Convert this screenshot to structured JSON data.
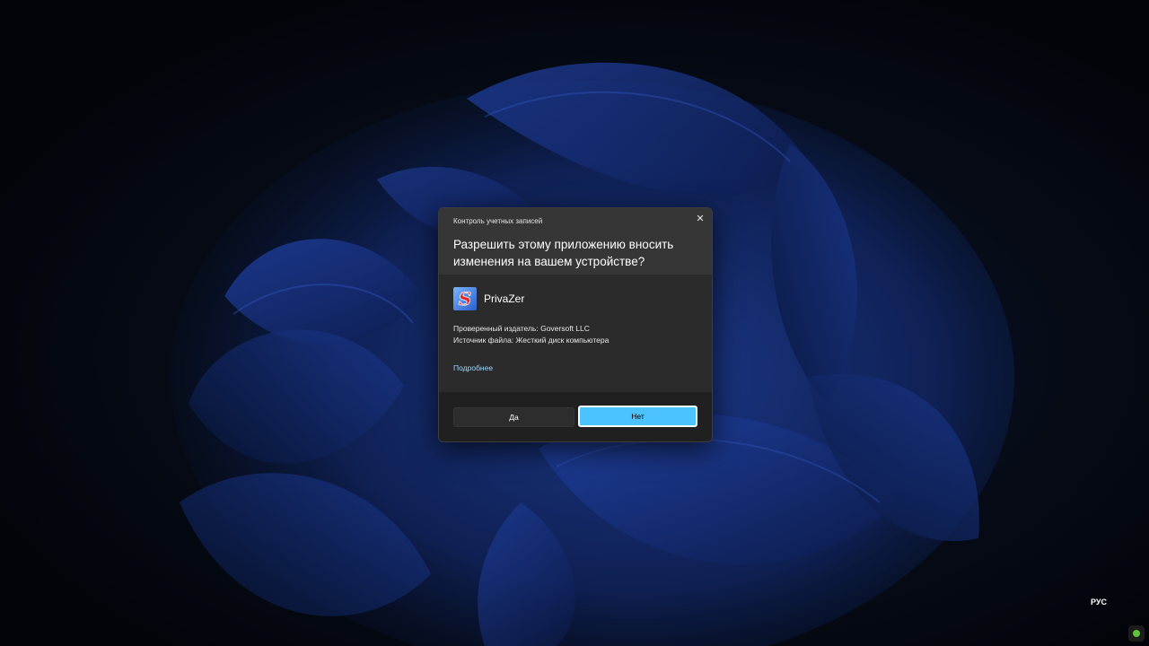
{
  "dialog": {
    "caption": "Контроль учетных записей",
    "question": "Разрешить этому приложению вносить изменения на вашем устройстве?",
    "app_name": "PrivaZer",
    "app_icon_letter": "S",
    "publisher": "Проверенный издатель: Goversoft LLC",
    "source": "Источник файла: Жесткий диск компьютера",
    "more_link": "Подробнее",
    "yes_label": "Да",
    "no_label": "Нет",
    "close_symbol": "✕"
  },
  "taskbar": {
    "language": "РУС"
  },
  "colors": {
    "accent": "#4cc2ff",
    "link": "#99d6ff",
    "dialog_bg": "#2b2b2b",
    "footer_bg": "#202020"
  },
  "icons": {
    "close": "close-icon",
    "app": "privazer-app-icon",
    "tray": "tray-status-icon"
  }
}
